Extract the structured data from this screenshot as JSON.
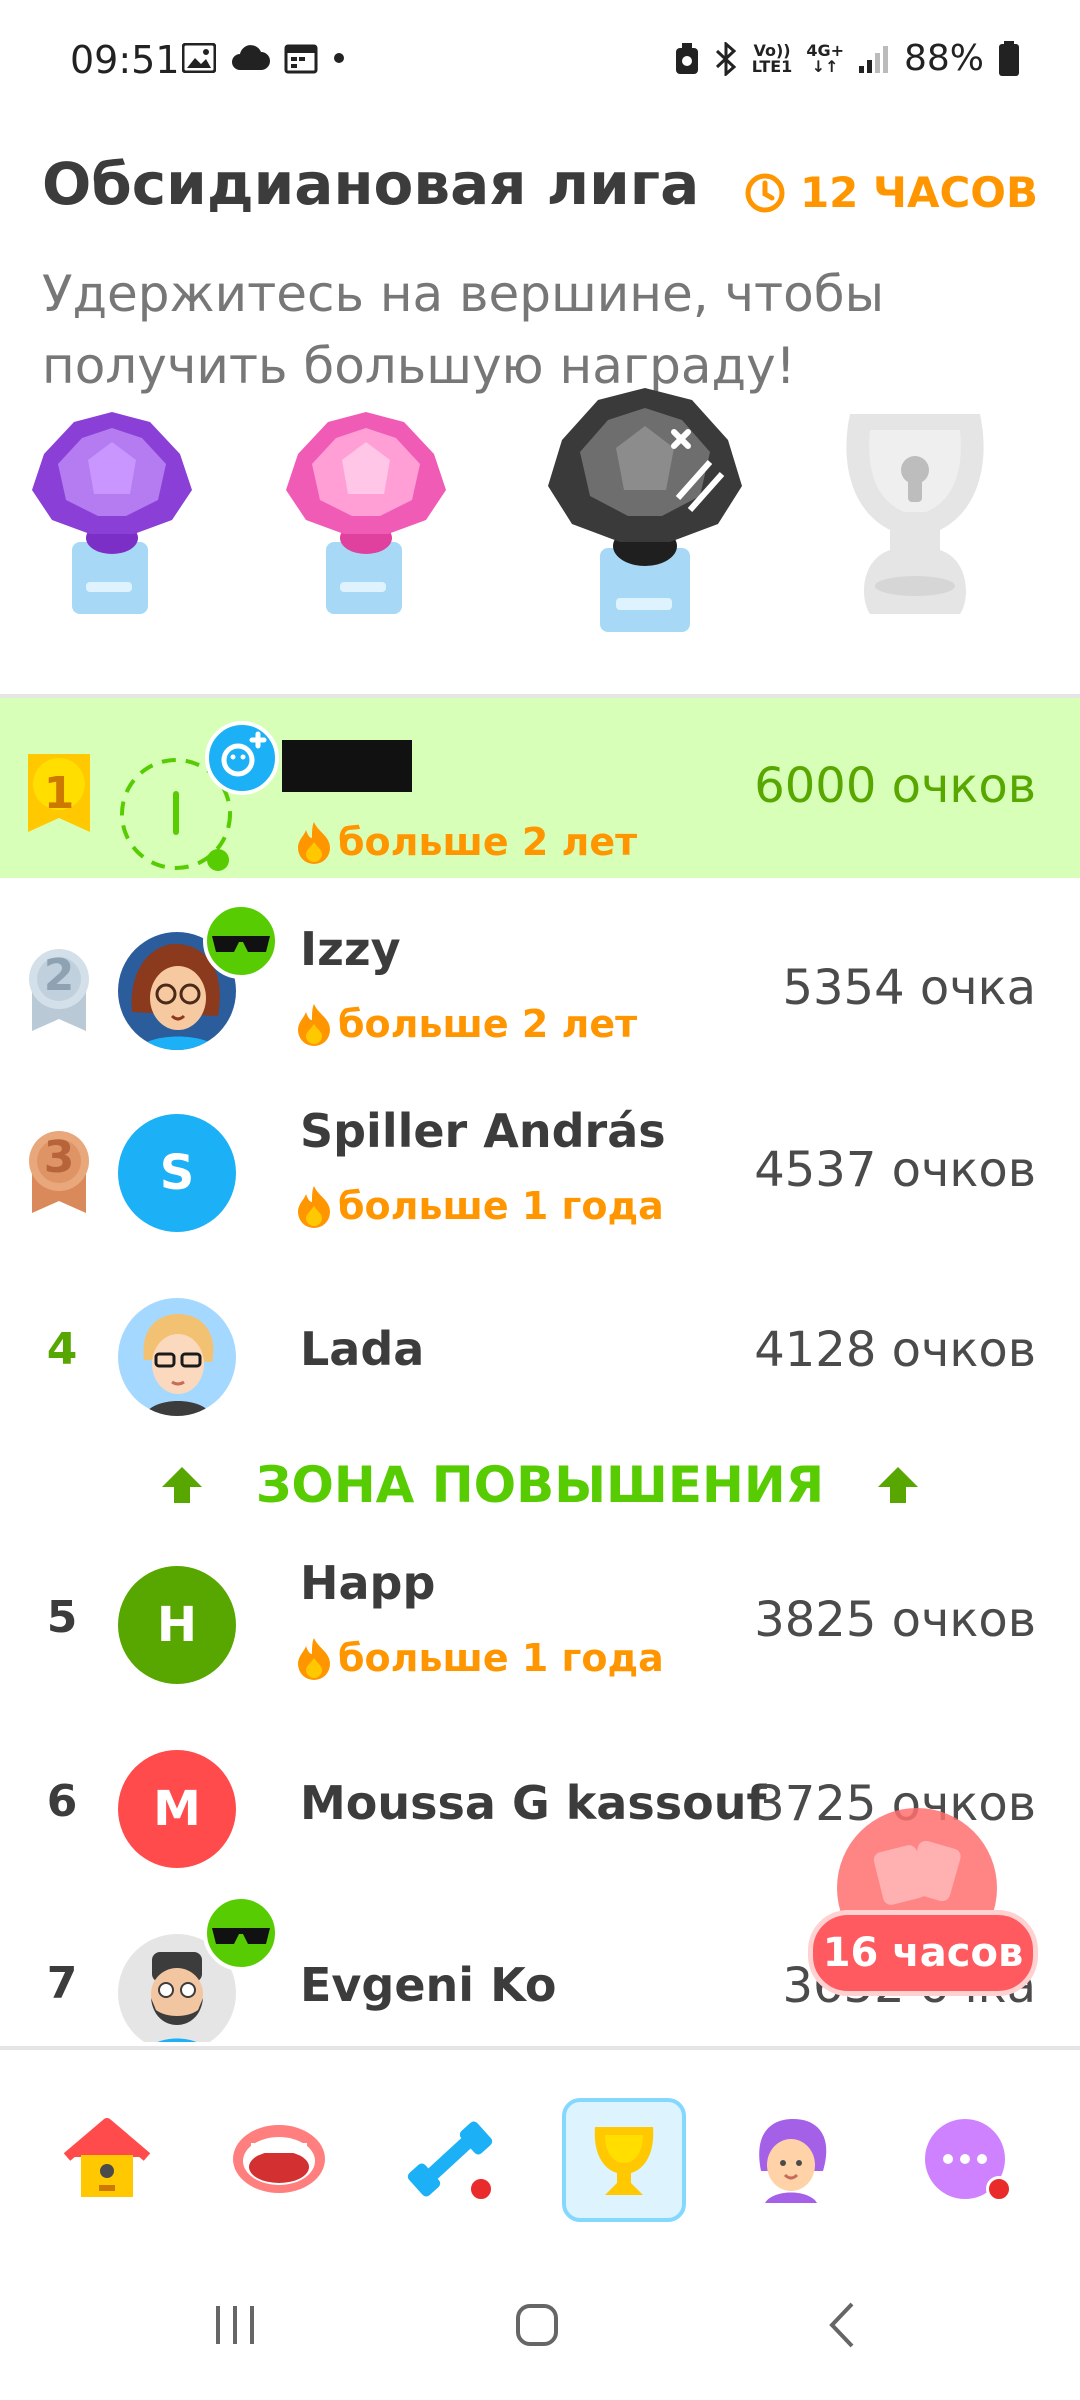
{
  "status_bar": {
    "time": "09:51",
    "left_icons": [
      "image-icon",
      "cloud-icon",
      "calendar-icon",
      "dot-icon"
    ],
    "right_icons": [
      "alarm-icon",
      "bluetooth-icon",
      "volte-icon",
      "4g-icon",
      "signal-icon",
      "battery-icon"
    ],
    "volte_top": "Vo))",
    "volte_bottom": "LTE1",
    "net_top": "4G+",
    "net_bottom": "↓↑",
    "battery": "88%"
  },
  "league": {
    "title": "Обсидиановая лига",
    "timer": "12 ЧАСОВ",
    "subtitle": "Удержитесь на вершине, чтобы получить большую награду!"
  },
  "trophies": [
    {
      "name": "amethyst",
      "color": "#a560e8",
      "state": "unlocked"
    },
    {
      "name": "pearl",
      "color": "#ff86d0",
      "state": "unlocked"
    },
    {
      "name": "obsidian",
      "color": "#4b4b4b",
      "state": "current"
    },
    {
      "name": "locked",
      "color": "#e5e5e5",
      "state": "locked"
    }
  ],
  "leaderboard": [
    {
      "rank": "1",
      "name": "",
      "streak": "больше 2 лет",
      "points": "6000 очков",
      "current_user": true
    },
    {
      "rank": "2",
      "name": "Izzy",
      "streak": "больше 2 лет",
      "points": "5354 очка"
    },
    {
      "rank": "3",
      "name": "Spiller András",
      "streak": "больше 1 года",
      "points": "4537 очков",
      "avatar_letter": "S",
      "avatar_color": "#1cb0f6"
    },
    {
      "rank": "4",
      "name": "Lada",
      "streak": "",
      "points": "4128 очков"
    },
    {
      "rank": "5",
      "name": "Happ",
      "streak": "больше 1 года",
      "points": "3825 очков",
      "avatar_letter": "H",
      "avatar_color": "#58a700"
    },
    {
      "rank": "6",
      "name": "Moussa G kassouf",
      "streak": "",
      "points": "3725 очков",
      "avatar_letter": "M",
      "avatar_color": "#ff4b4b"
    },
    {
      "rank": "7",
      "name": "Evgeni Ko",
      "streak": "",
      "points": "3652 очка"
    }
  ],
  "promotion_zone": "ЗОНА ПОВЫШЕНИЯ",
  "floating_badge": "16 часов",
  "bottom_nav": [
    {
      "name": "home-icon",
      "label": "Home"
    },
    {
      "name": "speaking-icon",
      "label": "Speaking"
    },
    {
      "name": "practice-icon",
      "label": "Practice",
      "dot": true
    },
    {
      "name": "leagues-icon",
      "label": "Leagues",
      "active": true
    },
    {
      "name": "profile-icon",
      "label": "Profile"
    },
    {
      "name": "more-icon",
      "label": "More",
      "dot": true
    }
  ]
}
